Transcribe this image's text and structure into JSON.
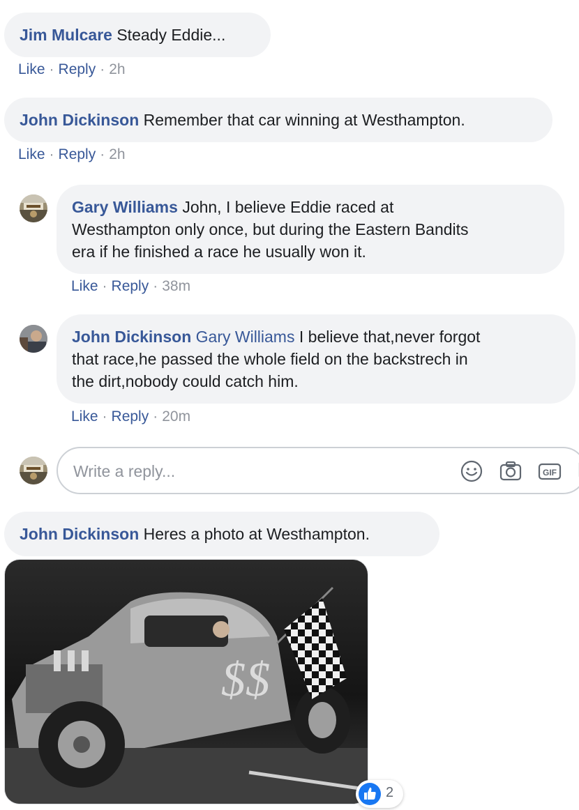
{
  "comments": [
    {
      "author": "Jim Mulcare",
      "text": "Steady Eddie...",
      "like": "Like",
      "reply": "Reply",
      "time": "2h"
    },
    {
      "author": "John Dickinson",
      "text": "Remember that car winning at Westhampton.",
      "like": "Like",
      "reply": "Reply",
      "time": "2h"
    },
    {
      "author": "John Dickinson",
      "text": "Heres a photo at Westhampton."
    }
  ],
  "replies": [
    {
      "author": "Gary Williams",
      "lines": [
        "John, I believe Eddie raced at",
        "Westhampton only once, but during the Eastern Bandits",
        "era if he finished a race he usually won it."
      ],
      "like": "Like",
      "reply": "Reply",
      "time": "38m"
    },
    {
      "author": "John Dickinson",
      "mention": "Gary Williams",
      "lines": [
        "I believe that,never forgot",
        "that race,he passed the whole field on the backstrech in",
        "the dirt,nobody could catch him."
      ],
      "like": "Like",
      "reply": "Reply",
      "time": "20m"
    }
  ],
  "reply_box": {
    "placeholder": "Write a reply...",
    "icons": [
      "emoji-icon",
      "camera-icon",
      "gif-icon"
    ]
  },
  "photo_reactions": {
    "type": "like",
    "count": "2"
  },
  "colors": {
    "link": "#385898",
    "bubble": "#f2f3f5",
    "meta": "#90949c",
    "like_blue": "#1877f2"
  }
}
